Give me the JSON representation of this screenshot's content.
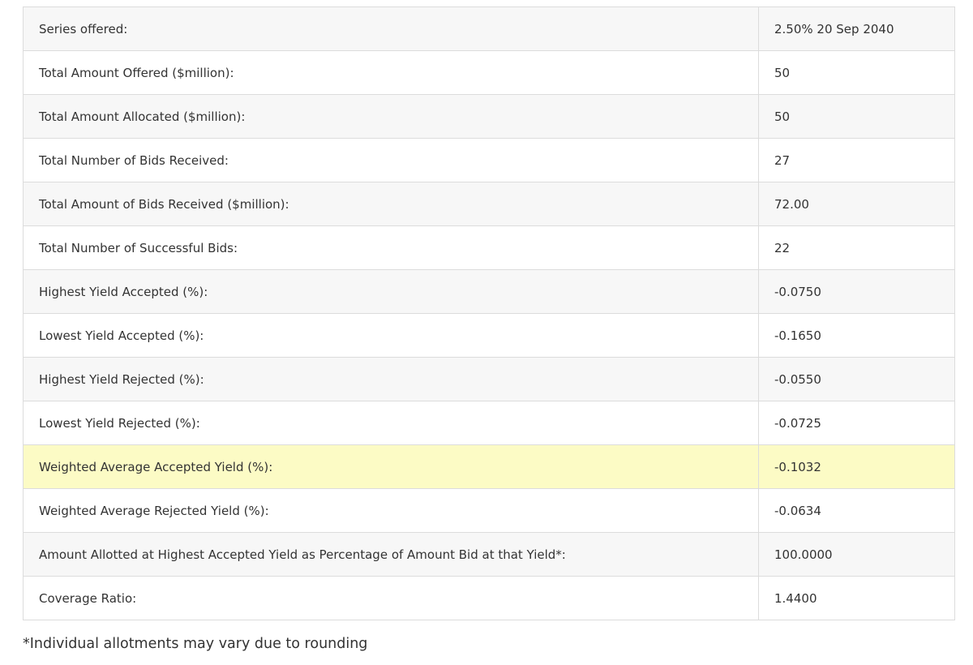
{
  "auction_results": {
    "rows": [
      {
        "label": "Series offered:",
        "value": "2.50% 20 Sep 2040"
      },
      {
        "label": "Total Amount Offered ($million):",
        "value": "50"
      },
      {
        "label": "Total Amount Allocated ($million):",
        "value": "50"
      },
      {
        "label": "Total Number of Bids Received:",
        "value": "27"
      },
      {
        "label": "Total Amount of Bids Received ($million):",
        "value": "72.00"
      },
      {
        "label": "Total Number of Successful Bids:",
        "value": "22"
      },
      {
        "label": "Highest Yield Accepted (%):",
        "value": "-0.0750"
      },
      {
        "label": "Lowest Yield Accepted (%):",
        "value": "-0.1650"
      },
      {
        "label": "Highest Yield Rejected (%):",
        "value": "-0.0550"
      },
      {
        "label": "Lowest Yield Rejected (%):",
        "value": "-0.0725"
      },
      {
        "label": "Weighted Average Accepted Yield (%):",
        "value": "-0.1032"
      },
      {
        "label": "Weighted Average Rejected Yield (%):",
        "value": "-0.0634"
      },
      {
        "label": "Amount Allotted at Highest Accepted Yield as Percentage of Amount Bid at that Yield*:",
        "value": "100.0000"
      },
      {
        "label": "Coverage Ratio:",
        "value": "1.4400"
      }
    ],
    "highlight_color": "#fcfbc5",
    "stripe_color": "#f7f7f7",
    "border_color": "#dcdcdc"
  },
  "footnote": "*Individual allotments may vary due to rounding"
}
